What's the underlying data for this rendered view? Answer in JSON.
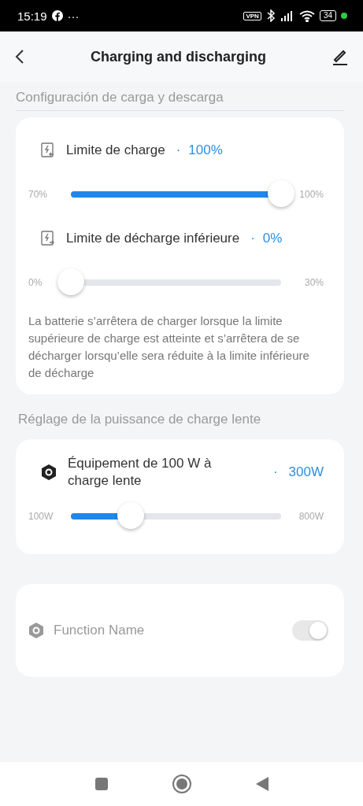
{
  "status_bar": {
    "time": "15:19",
    "more": "···",
    "vpn": "VPN",
    "battery": "34"
  },
  "header": {
    "title": "Charging and discharging"
  },
  "groups": [
    {
      "title": "Configuración de carga y descarga",
      "divider": true,
      "items": [
        {
          "kind": "slider",
          "label": "Limite de charge",
          "separator": "·",
          "value": "100%",
          "min": "70%",
          "max": "100%",
          "level": 1
        },
        {
          "kind": "slider",
          "label": "Limite de décharge inférieure",
          "separator": "·",
          "value": "0%",
          "min": "0%",
          "max": "30%",
          "level": 0
        }
      ],
      "note": "La batterie s’arrêtera de charger lorsque la limite supérieure de charge est atteinte et s’arrêtera de se décharger lorsqu’elle sera réduite à la limite inférieure de décharge"
    },
    {
      "title": "Réglage de la puissance de charge lente",
      "divider": false,
      "items": [
        {
          "kind": "slider",
          "label": "Équipement de 100 W à charge lente",
          "separator": "·",
          "value": "300W",
          "min": "100W",
          "max": "800W",
          "level": 0.286
        }
      ]
    },
    {
      "items": [
        {
          "kind": "toggle",
          "label": "Function Name",
          "on": true,
          "disabled": true
        }
      ]
    }
  ]
}
